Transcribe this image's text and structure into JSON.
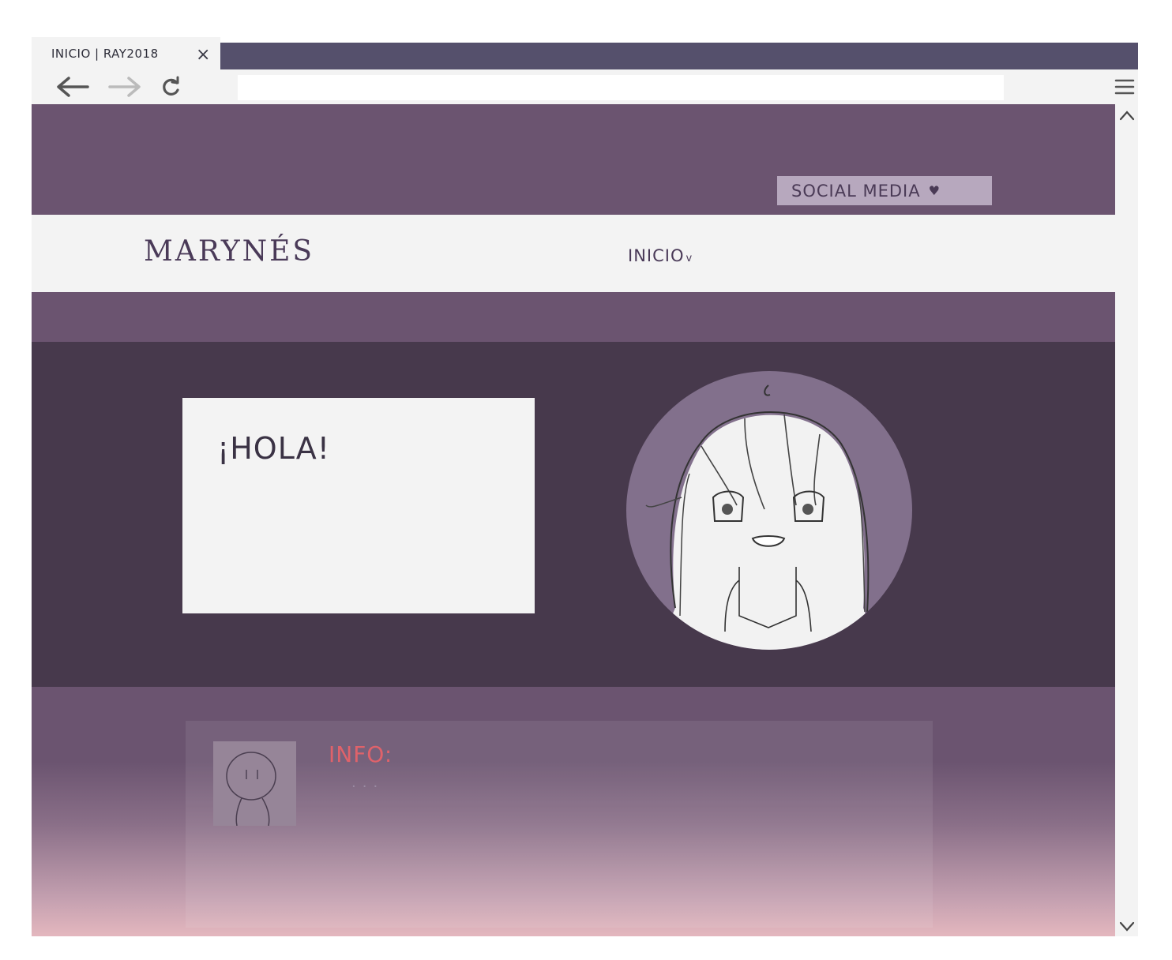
{
  "browser": {
    "tab_title": "INICIO | RAY2018",
    "tab_close": "×",
    "url": ""
  },
  "header": {
    "social_label": "SOCIAL MEDIA",
    "social_heart": "♥"
  },
  "nav": {
    "site_name": "MARYNÉS",
    "inicio_label": "INICIO",
    "inicio_caret": "v"
  },
  "hero": {
    "greeting": "¡HOLA!"
  },
  "info": {
    "label": "INFO:",
    "dots": "..."
  },
  "icons": {
    "back": "arrow-left-icon",
    "forward": "arrow-right-icon",
    "reload": "reload-icon",
    "menu": "hamburger-menu-icon",
    "scroll_up": "chevron-up-icon",
    "scroll_down": "chevron-down-icon"
  },
  "colors": {
    "tabstrip": "#55506c",
    "purple_band": "#6b5470",
    "hero_bg": "#47394c",
    "social_button": "#b7a8be",
    "avatar_bg": "#82708c",
    "info_label": "#e0626a",
    "gradient_bottom": "#e4b7be"
  }
}
